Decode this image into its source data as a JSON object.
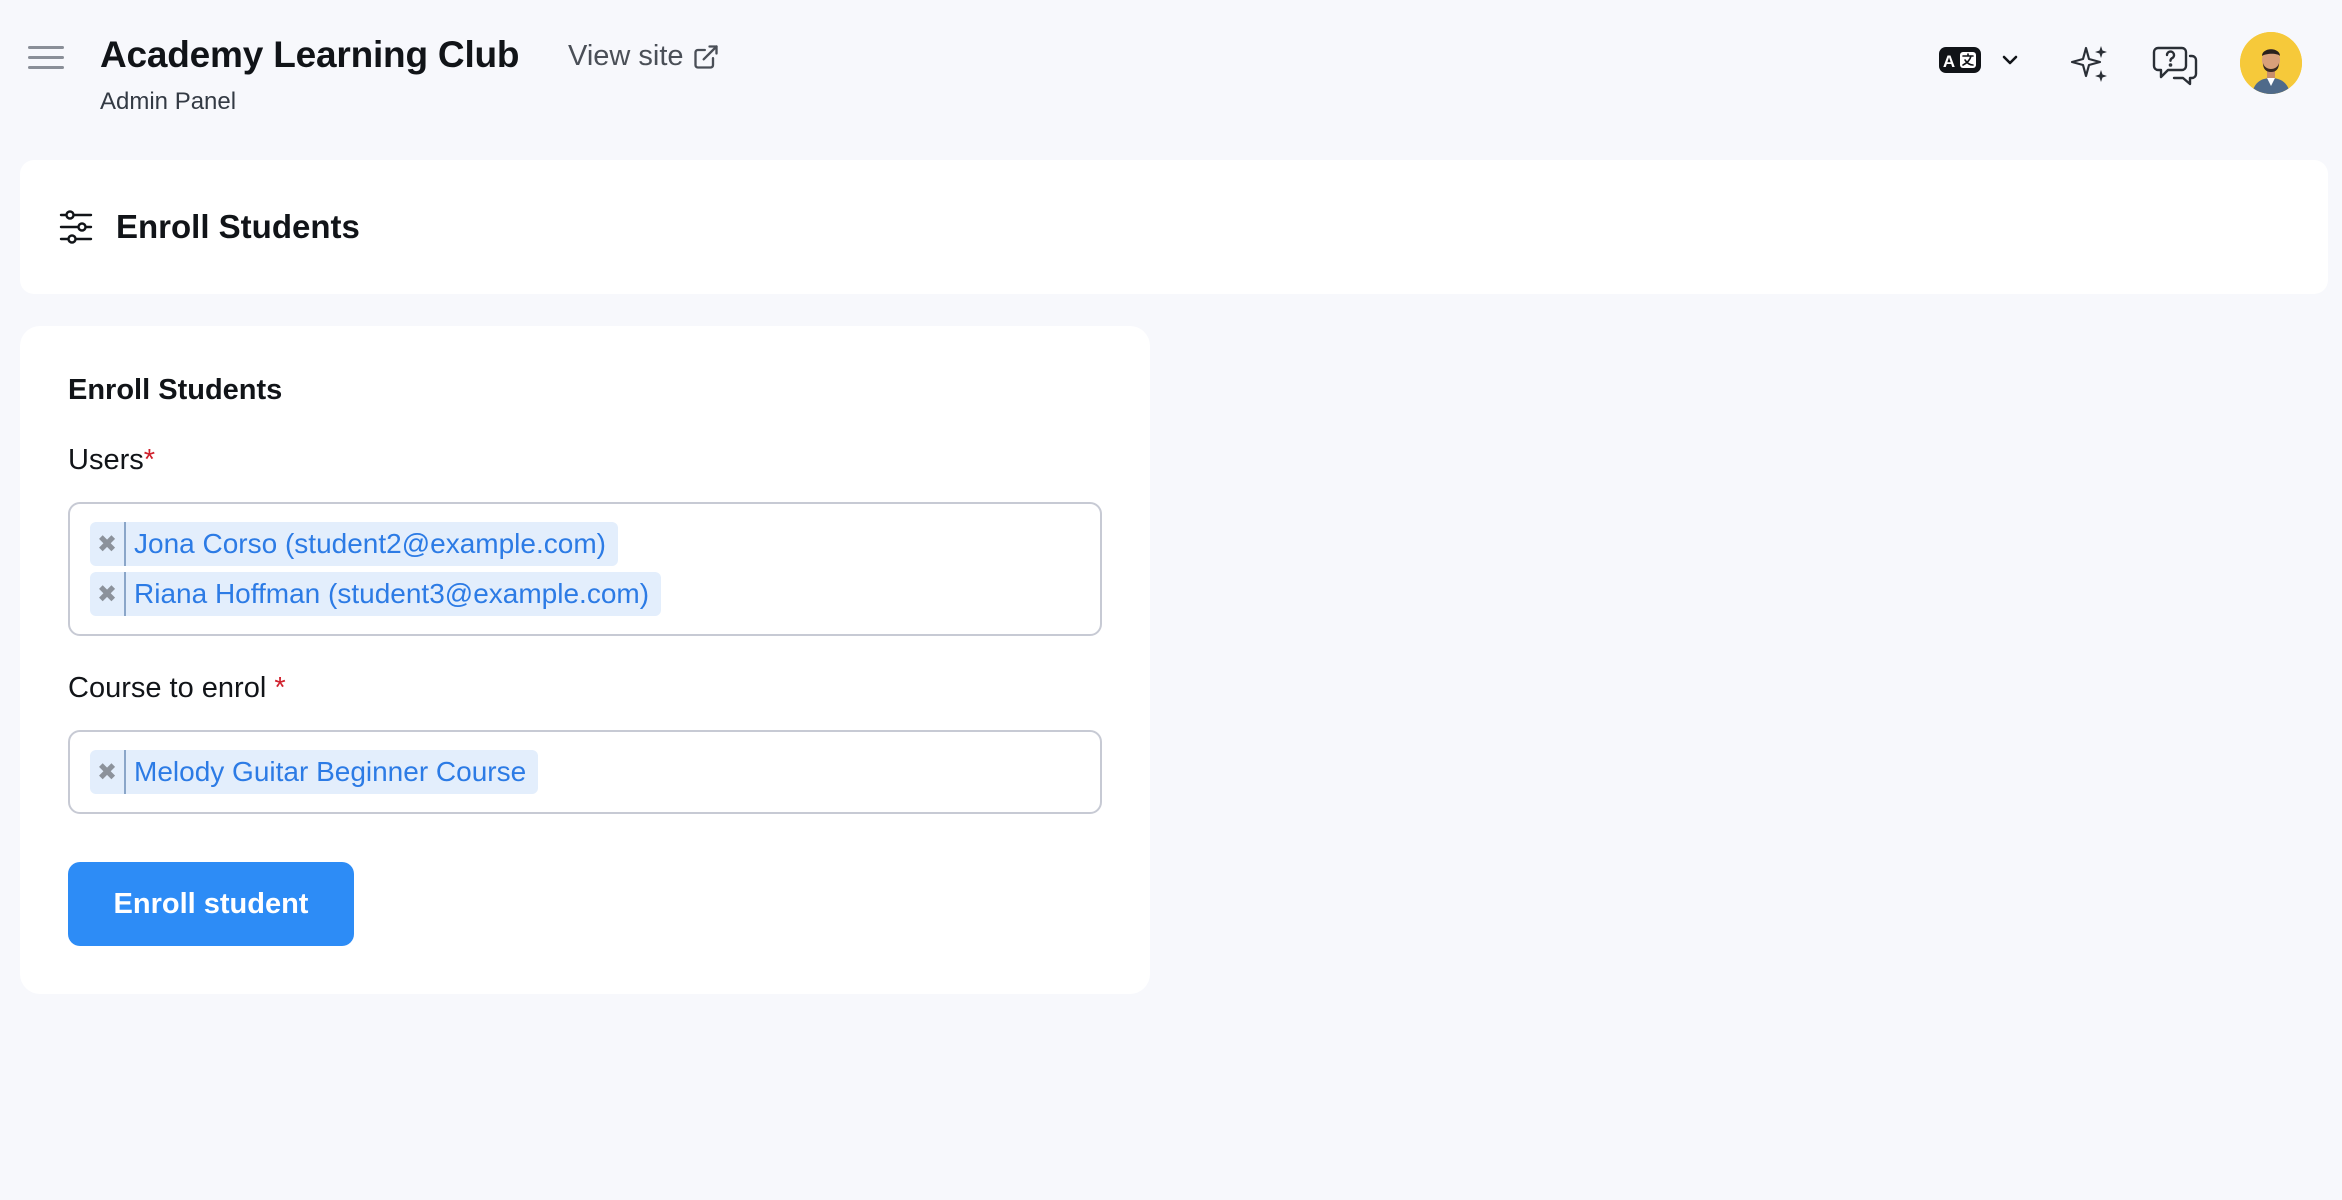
{
  "header": {
    "app_title": "Academy Learning Club",
    "app_subtitle": "Admin Panel",
    "view_site_label": "View site"
  },
  "page": {
    "title": "Enroll Students"
  },
  "form": {
    "heading": "Enroll Students",
    "users": {
      "label": "Users",
      "required_mark": "*",
      "selected": [
        "Jona Corso (student2@example.com)",
        "Riana Hoffman (student3@example.com)"
      ]
    },
    "course": {
      "label": "Course to enrol ",
      "required_mark": "*",
      "selected": [
        "Melody Guitar Beginner Course"
      ]
    },
    "submit_label": "Enroll student",
    "remove_glyph": "✖"
  },
  "icons": {
    "menu": "hamburger-menu-icon",
    "external": "external-link-icon",
    "language": "translate-icon",
    "ai": "sparkles-icon",
    "help": "help-chat-icon",
    "filter": "sliders-icon"
  },
  "colors": {
    "accent": "#2d8cf6",
    "tag_bg": "#e3eefc",
    "tag_text": "#2c7be5",
    "required": "#d0202c",
    "avatar_bg": "#f6c93a"
  }
}
